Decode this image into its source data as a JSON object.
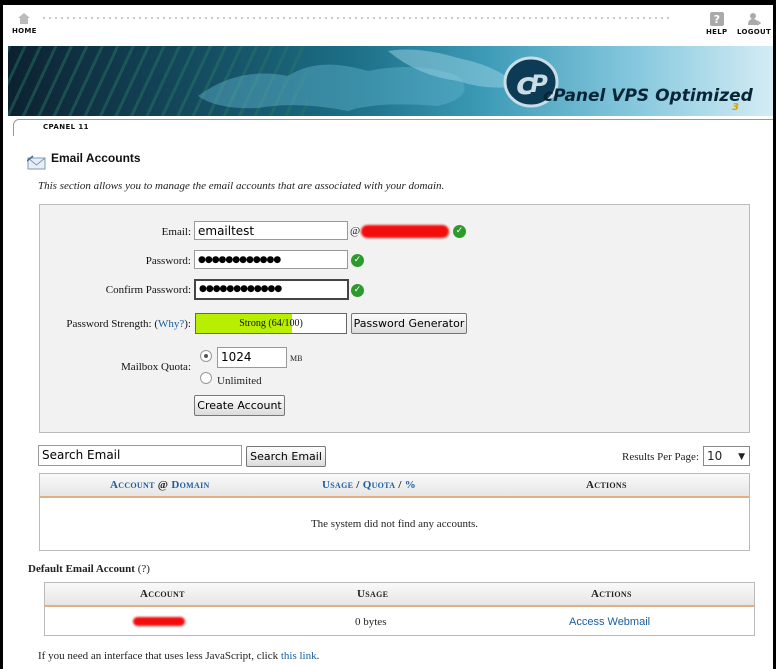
{
  "nav": {
    "home_label": "HOME",
    "help_label": "HELP",
    "logout_label": "LOGOUT"
  },
  "banner": {
    "logo_text": "cPanel VPS Optimized",
    "logo_version": "3"
  },
  "breadcrumb": "CPANEL 11",
  "page": {
    "title": "Email Accounts",
    "description": "This section allows you to manage the email accounts that are associated with your domain."
  },
  "form": {
    "email_label": "Email:",
    "email_value": "emailtest",
    "at_sign": "@",
    "password_label": "Password:",
    "password_value": "●●●●●●●●●●●●",
    "confirm_label": "Confirm Password:",
    "confirm_value": "●●●●●●●●●●●●",
    "strength_label": "Password Strength:",
    "strength_why": "(Why?)",
    "strength_why_open": "(",
    "strength_why_link": "Why?",
    "strength_why_close": "):",
    "strength_text": "Strong (64/100)",
    "strength_score": 64,
    "password_generator_label": "Password Generator",
    "quota_label": "Mailbox Quota:",
    "quota_value": "1024",
    "quota_unit": "MB",
    "unlimited_label": "Unlimited",
    "quota_selected": "1024",
    "create_label": "Create Account"
  },
  "search": {
    "value": "Search Email",
    "button_label": "Search Email",
    "results_label": "Results Per Page:",
    "results_value": "10"
  },
  "accounts_table": {
    "col_account": "Account",
    "col_at": "@",
    "col_domain": "Domain",
    "col_usage": "Usage",
    "col_quota": "Quota",
    "col_slash": "/",
    "col_pct": "%",
    "col_actions": "Actions",
    "empty_message": "The system did not find any accounts."
  },
  "default_account": {
    "heading": "Default Email Account",
    "help": "(?)",
    "col_account": "Account",
    "col_usage": "Usage",
    "col_actions": "Actions",
    "usage_value": "0 bytes",
    "action_label": "Access Webmail"
  },
  "footer": {
    "text": "If you need an interface that uses less JavaScript, click",
    "link": "this link",
    "end": "."
  },
  "colors": {
    "link": "#1a5fa0",
    "strength_fill": "#b8ef00",
    "check": "#2e9a2e",
    "redaction": "#f20c0c"
  }
}
